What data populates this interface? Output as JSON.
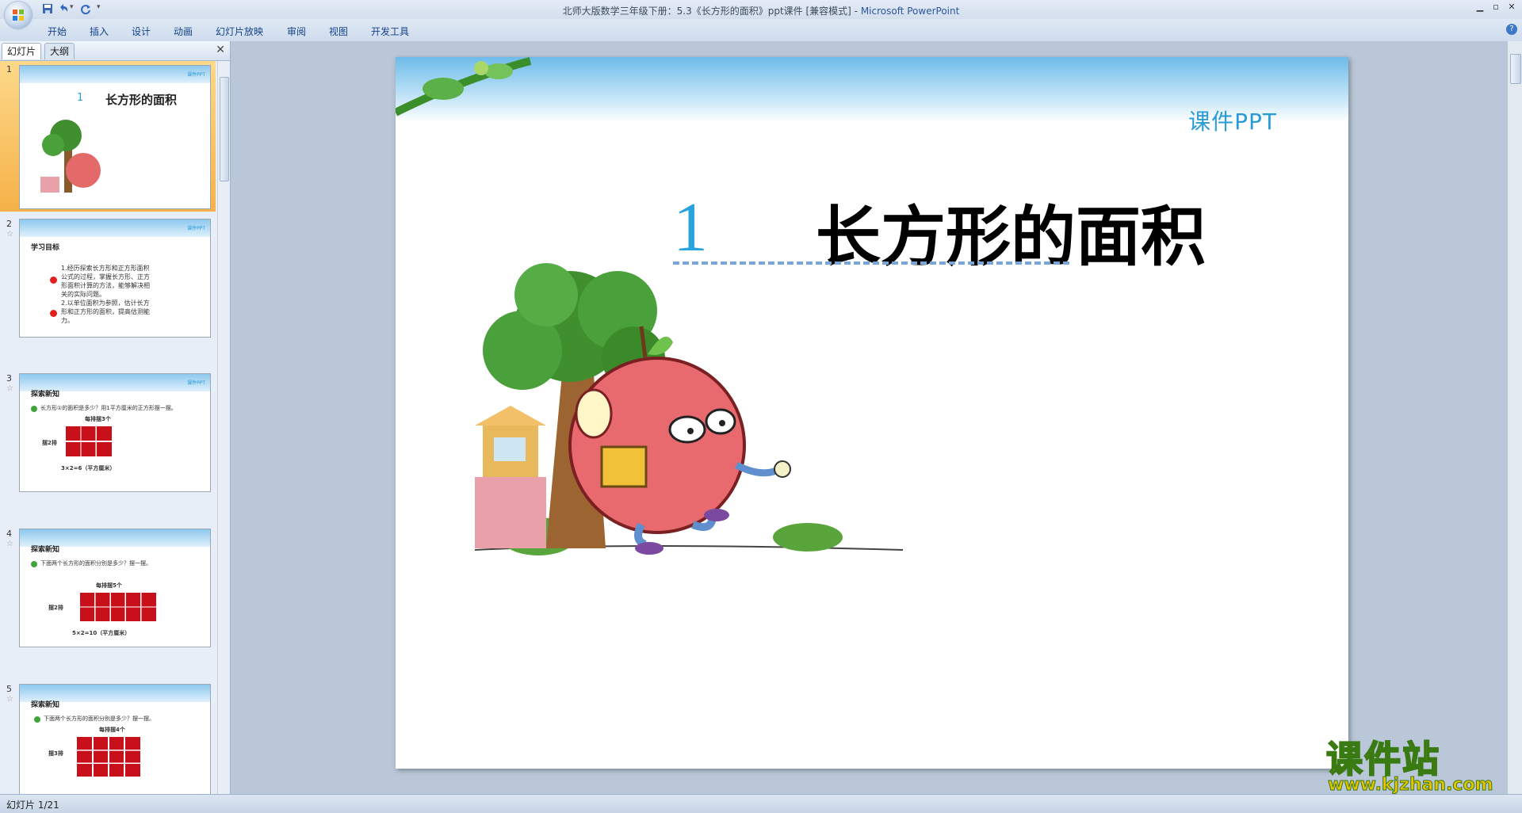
{
  "window": {
    "title": "北师大版数学三年级下册：5.3《长方形的面积》ppt课件 [兼容模式] - ",
    "app_name": "Microsoft PowerPoint"
  },
  "ribbon": {
    "tabs": [
      "开始",
      "插入",
      "设计",
      "动画",
      "幻灯片放映",
      "审阅",
      "视图",
      "开发工具"
    ]
  },
  "panel": {
    "tab_slides": "幻灯片",
    "tab_outline": "大纲",
    "thumbnails": [
      {
        "num": "1",
        "title_num": "1",
        "title": "长方形的面积"
      },
      {
        "num": "2",
        "heading": "学习目标",
        "lines": [
          "1.经历探索长方形和正方形面积",
          "公式的过程，掌握长方形、正方",
          "形面积计算的方法，能够解决相",
          "关的实际问题。",
          "2.以单位面积为参照，估计长方",
          "形和正方形的面积，提高估测能",
          "力。"
        ]
      },
      {
        "num": "3",
        "heading": "探索新知",
        "question": "长方形①的面积是多少？用1平方厘米的正方形摆一摆。",
        "top_label": "每排摆3个",
        "side_label": "摆2排",
        "formula": "3×2=6（平方厘米）"
      },
      {
        "num": "4",
        "heading": "探索新知",
        "question": "下面两个长方形的面积分别是多少？摆一摆。",
        "top_label": "每排摆5个",
        "side_label": "摆2排",
        "formula": "5×2=10（平方厘米）"
      },
      {
        "num": "5",
        "heading": "探索新知",
        "question": "下面两个长方形的面积分别是多少？摆一摆。",
        "top_label": "每排摆4个",
        "side_label": "摆3排"
      }
    ],
    "thumb_ppt_label": "课件PPT"
  },
  "slide": {
    "ppt_label": "课件PPT",
    "number": "1",
    "title": "长方形的面积"
  },
  "status": {
    "text": "幻灯片 1/21"
  },
  "watermark": {
    "text": "课件站",
    "url": "www.kjzhan.com"
  },
  "icons": {
    "office": "office-logo-icon",
    "save": "save-icon",
    "undo": "undo-icon",
    "redo": "redo-icon",
    "help": "help-icon"
  }
}
